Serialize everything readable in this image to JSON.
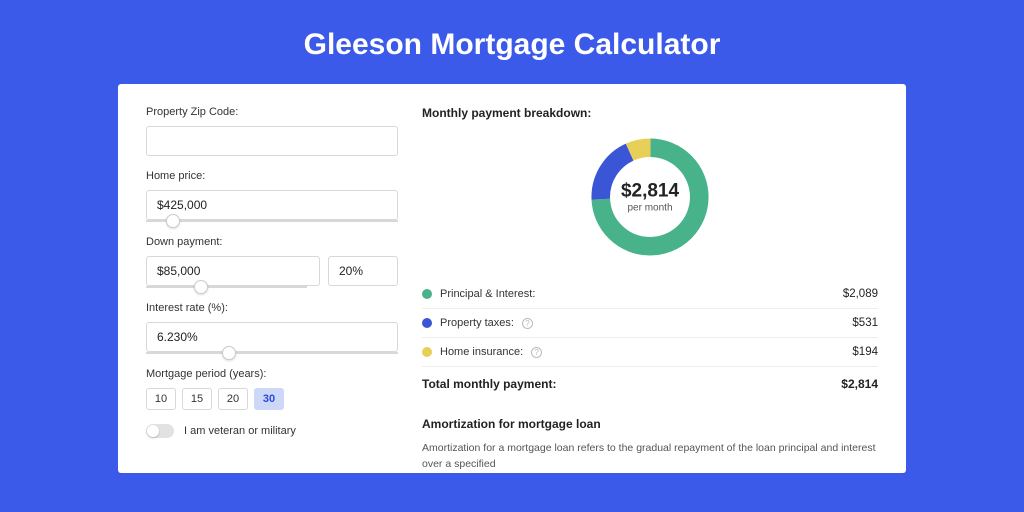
{
  "page": {
    "title": "Gleeson Mortgage Calculator"
  },
  "form": {
    "zip": {
      "label": "Property Zip Code:",
      "value": ""
    },
    "home_price": {
      "label": "Home price:",
      "value": "$425,000",
      "slider_pct": 8
    },
    "down_payment": {
      "label": "Down payment:",
      "value": "$85,000",
      "percent": "20%",
      "slider_pct": 20
    },
    "interest_rate": {
      "label": "Interest rate (%):",
      "value": "6.230%",
      "slider_pct": 30
    },
    "mortgage_period": {
      "label": "Mortgage period (years):",
      "options": [
        "10",
        "15",
        "20",
        "30"
      ],
      "selected": "30"
    },
    "veteran": {
      "label": "I am veteran or military",
      "checked": false
    }
  },
  "breakdown": {
    "title": "Monthly payment breakdown:",
    "center_amount": "$2,814",
    "center_sub": "per month",
    "items": [
      {
        "label": "Principal & Interest:",
        "value": "$2,089",
        "color": "green",
        "info": false
      },
      {
        "label": "Property taxes:",
        "value": "$531",
        "color": "blue",
        "info": true
      },
      {
        "label": "Home insurance:",
        "value": "$194",
        "color": "yellow",
        "info": true
      }
    ],
    "total_label": "Total monthly payment:",
    "total_value": "$2,814"
  },
  "amortization": {
    "title": "Amortization for mortgage loan",
    "text": "Amortization for a mortgage loan refers to the gradual repayment of the loan principal and interest over a specified"
  },
  "chart_data": {
    "type": "pie",
    "title": "Monthly payment breakdown",
    "series": [
      {
        "name": "Principal & Interest",
        "value": 2089,
        "color": "#48b28b"
      },
      {
        "name": "Property taxes",
        "value": 531,
        "color": "#3a56d6"
      },
      {
        "name": "Home insurance",
        "value": 194,
        "color": "#e8cf57"
      }
    ],
    "total": 2814
  }
}
